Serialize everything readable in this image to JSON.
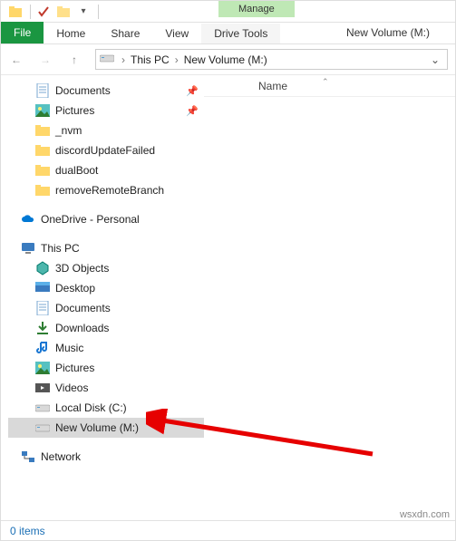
{
  "window_title": "New Volume (M:)",
  "ribbon": {
    "file": "File",
    "tabs": [
      "Home",
      "Share",
      "View"
    ],
    "context_header": "Manage",
    "context_tab": "Drive Tools"
  },
  "breadcrumb": {
    "root": "This PC",
    "current": "New Volume (M:)"
  },
  "quick_access": [
    {
      "label": "Documents",
      "icon": "doc",
      "pinned": true
    },
    {
      "label": "Pictures",
      "icon": "pic",
      "pinned": true
    },
    {
      "label": "_nvm",
      "icon": "folder",
      "pinned": false
    },
    {
      "label": "discordUpdateFailed",
      "icon": "folder",
      "pinned": false
    },
    {
      "label": "dualBoot",
      "icon": "folder",
      "pinned": false
    },
    {
      "label": "removeRemoteBranch",
      "icon": "folder",
      "pinned": false
    }
  ],
  "onedrive_label": "OneDrive - Personal",
  "this_pc_label": "This PC",
  "this_pc_children": [
    {
      "label": "3D Objects",
      "icon": "3d"
    },
    {
      "label": "Desktop",
      "icon": "desktop"
    },
    {
      "label": "Documents",
      "icon": "doc"
    },
    {
      "label": "Downloads",
      "icon": "downloads"
    },
    {
      "label": "Music",
      "icon": "music"
    },
    {
      "label": "Pictures",
      "icon": "pic"
    },
    {
      "label": "Videos",
      "icon": "videos"
    },
    {
      "label": "Local Disk (C:)",
      "icon": "drive"
    },
    {
      "label": "New Volume (M:)",
      "icon": "drive",
      "selected": true
    }
  ],
  "network_label": "Network",
  "list_header": "Name",
  "status_bar": "0 items",
  "watermark": "wsxdn.com"
}
